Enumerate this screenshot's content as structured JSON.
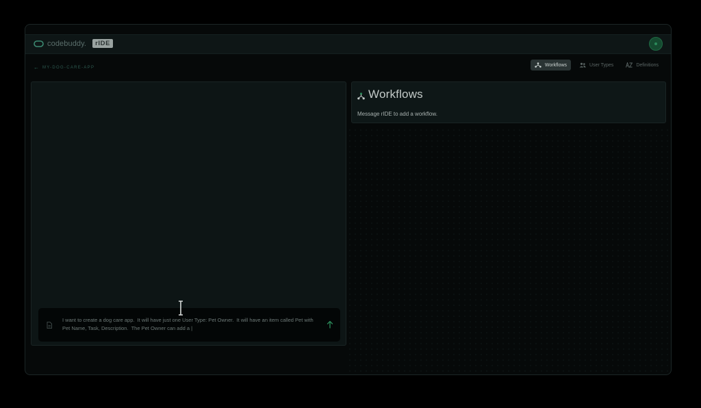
{
  "brand": {
    "name": "codebuddy.",
    "badge": "rIDE"
  },
  "breadcrumb": {
    "label": "MY-DOG-CARE-APP"
  },
  "tabs": [
    {
      "label": "Workflows",
      "icon": "workflow-icon",
      "active": true
    },
    {
      "label": "User Types",
      "icon": "users-icon",
      "active": false
    },
    {
      "label": "Definitions",
      "icon": "az-icon",
      "active": false
    }
  ],
  "chat": {
    "value": "I want to create a dog care app.  It will have just one User Type: Pet Owner.  It will have an item called Pet with Pet Name, Task, Description.  The Pet Owner can add a |"
  },
  "workflows_panel": {
    "title": "Workflows",
    "message": "Message rIDE to add a workflow."
  },
  "colors": {
    "accent": "#2b8a5a",
    "background": "#000000",
    "panel": "#0d1515"
  }
}
